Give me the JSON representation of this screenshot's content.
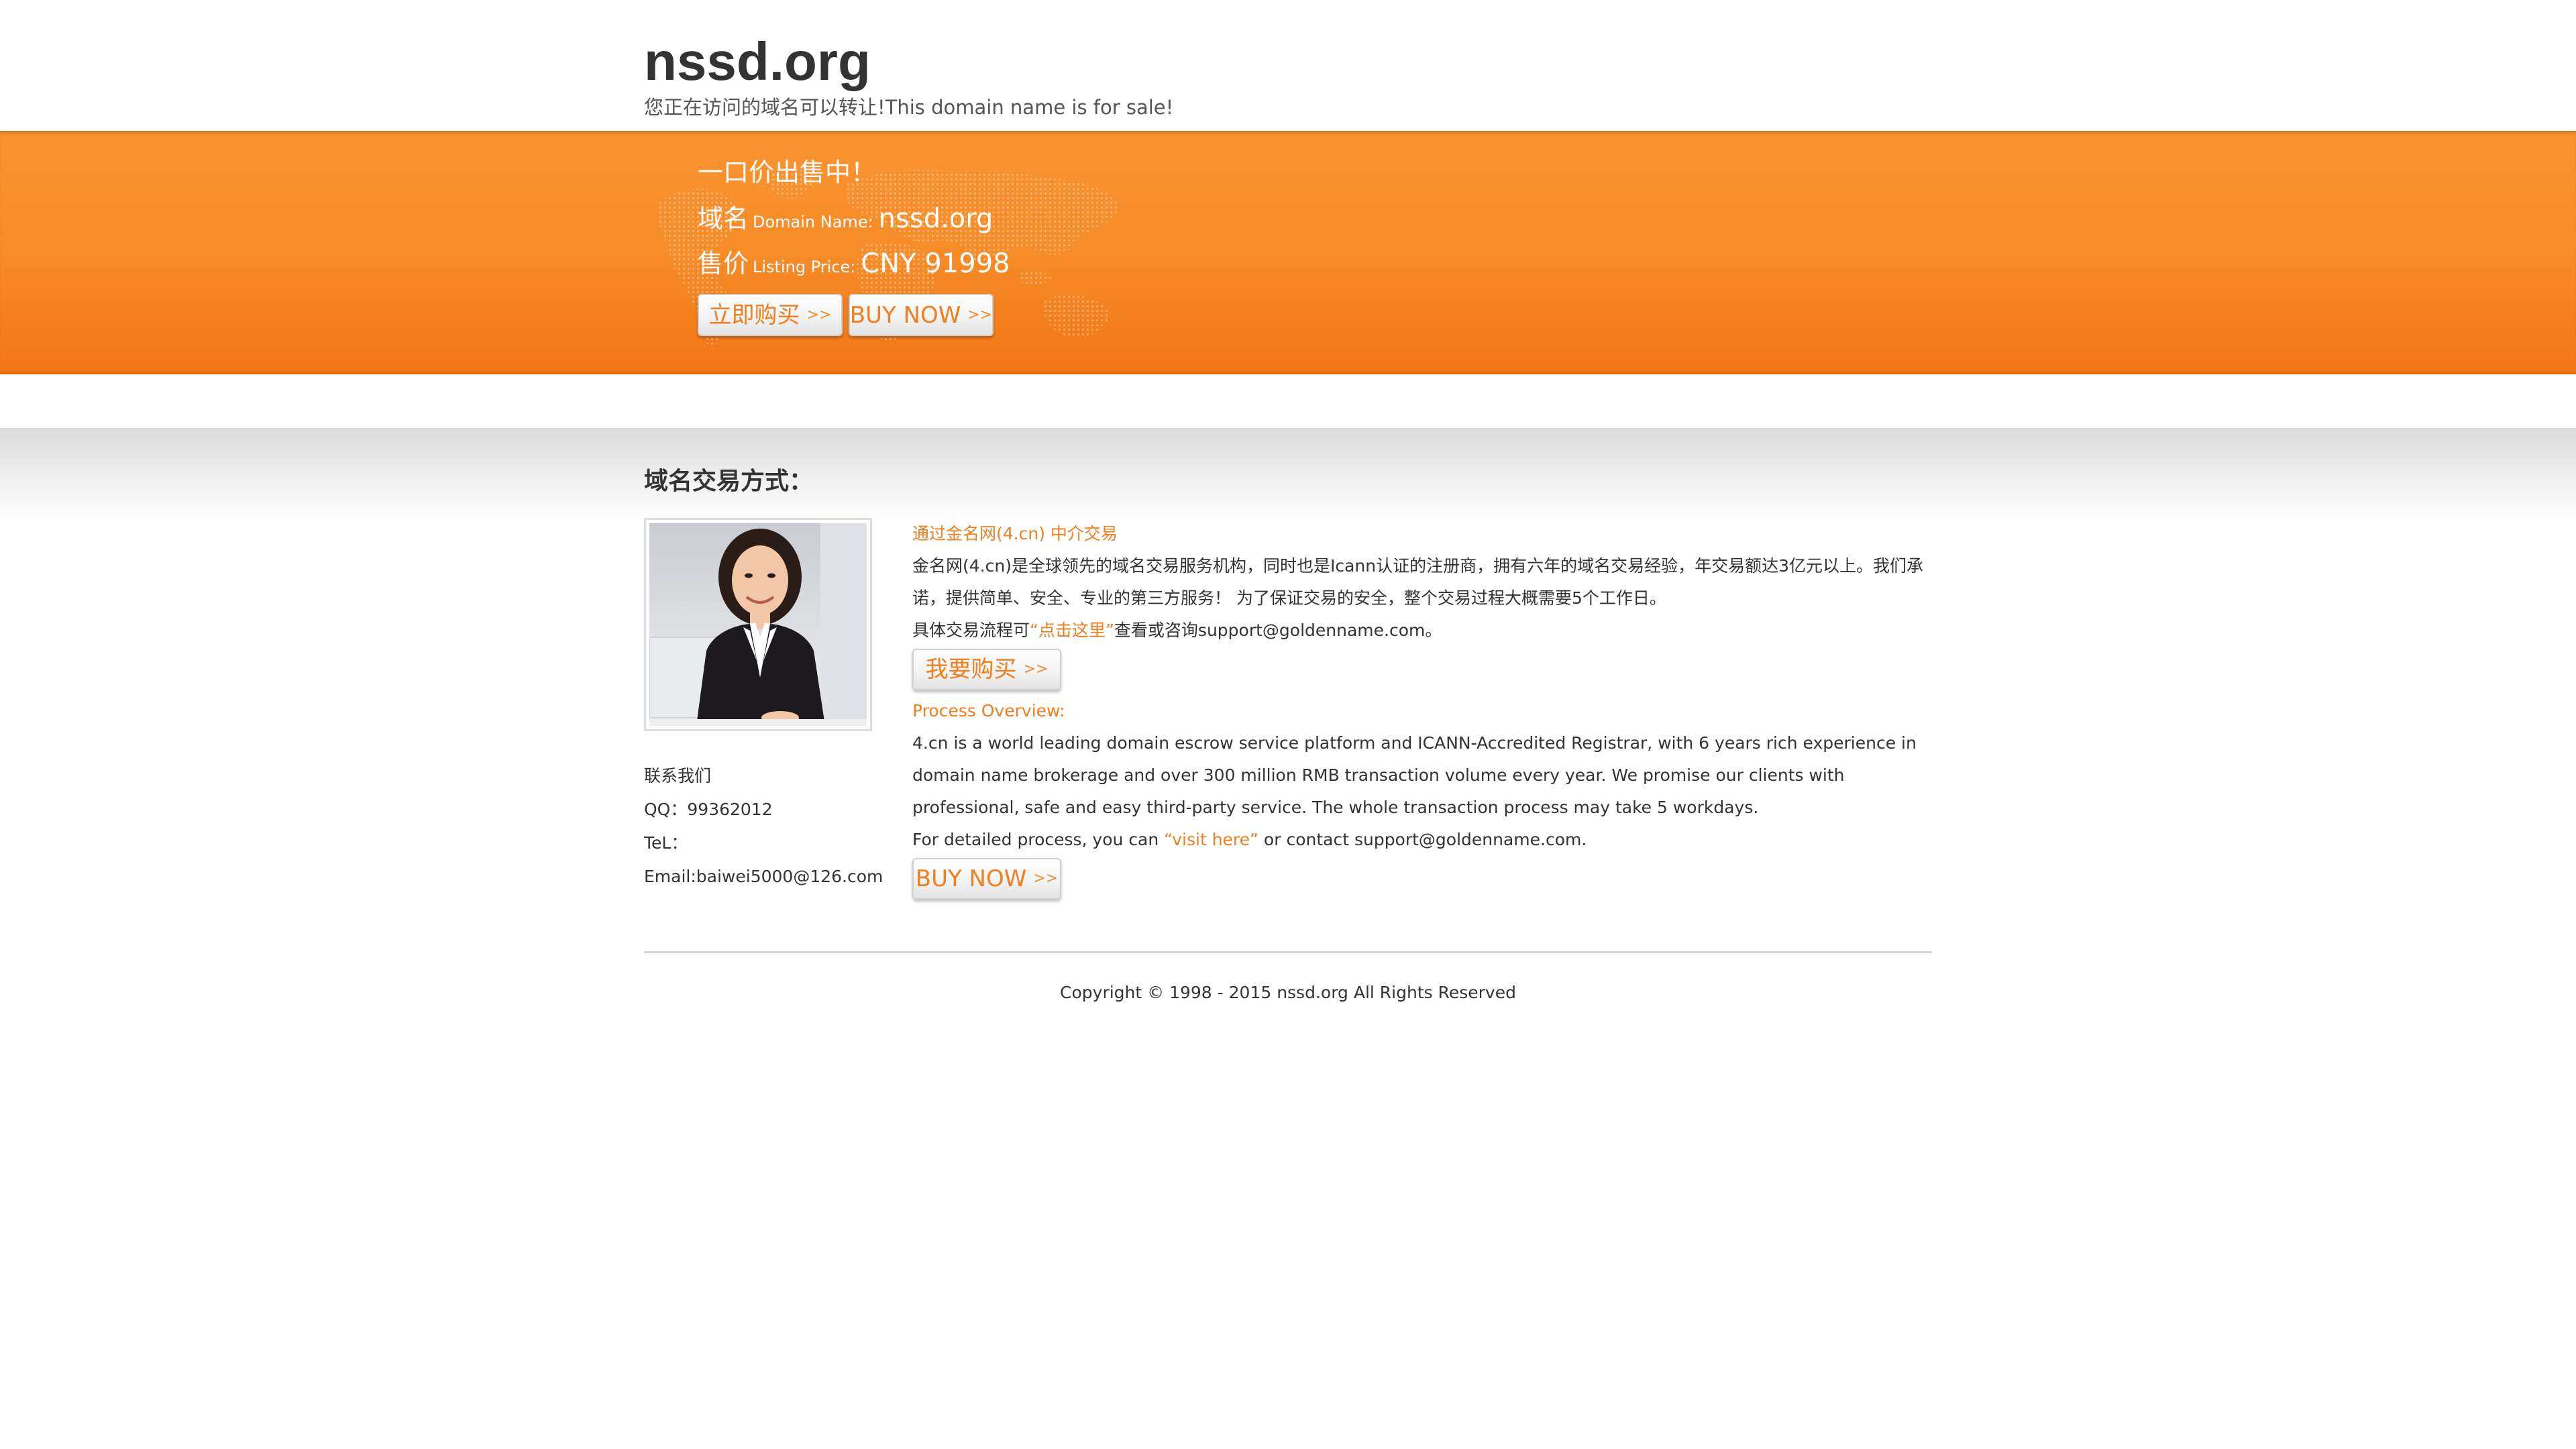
{
  "header": {
    "title": "nssd.org",
    "subtitle": "您正在访问的域名可以转让!This domain name is for sale!"
  },
  "banner": {
    "heading": "一口价出售中！",
    "domain_label_zh": "域名",
    "domain_label_en": "Domain Name:",
    "domain_value": "nssd.org",
    "price_label_zh": "售价",
    "price_label_en": "Listing Price:",
    "price_value": "CNY 91998",
    "buy_button_zh": "立即购买",
    "buy_button_en": "BUY NOW",
    "arrows": ">>"
  },
  "transaction": {
    "title": "域名交易方式：",
    "photo_icon": "customer-service-agent",
    "contact": {
      "heading": "联系我们",
      "qq": "QQ：99362012",
      "tel": "TeL：",
      "email": "Email:baiwei5000@126.com"
    },
    "zh": {
      "heading": "通过金名网(4.cn) 中介交易",
      "body": "金名网(4.cn)是全球领先的域名交易服务机构，同时也是Icann认证的注册商，拥有六年的域名交易经验，年交易额达3亿元以上。我们承诺，提供简单、安全、专业的第三方服务！ 为了保证交易的安全，整个交易过程大概需要5个工作日。",
      "detail_prefix": "具体交易流程可",
      "detail_link": "“点击这里”",
      "detail_suffix": "查看或咨询support@goldenname.com。",
      "button": "我要购买"
    },
    "en": {
      "heading": "Process Overview:",
      "body": "4.cn is a world leading domain escrow service platform and ICANN-Accredited Registrar, with 6 years rich experience in domain name brokerage and over 300 million RMB transaction volume every year. We promise our clients with professional, safe and easy third-party service. The whole transaction process may take 5 workdays.",
      "detail_prefix": "For detailed process, you can ",
      "detail_link": "“visit here”",
      "detail_suffix": " or contact support@goldenname.com.",
      "button": "BUY NOW"
    }
  },
  "footer": {
    "copyright": "Copyright © 1998 - 2015 nssd.org All Rights Reserved"
  },
  "colors": {
    "accent": "#f27e1d",
    "banner_top": "#f99330",
    "banner_bottom": "#f27515",
    "text": "#333333"
  }
}
